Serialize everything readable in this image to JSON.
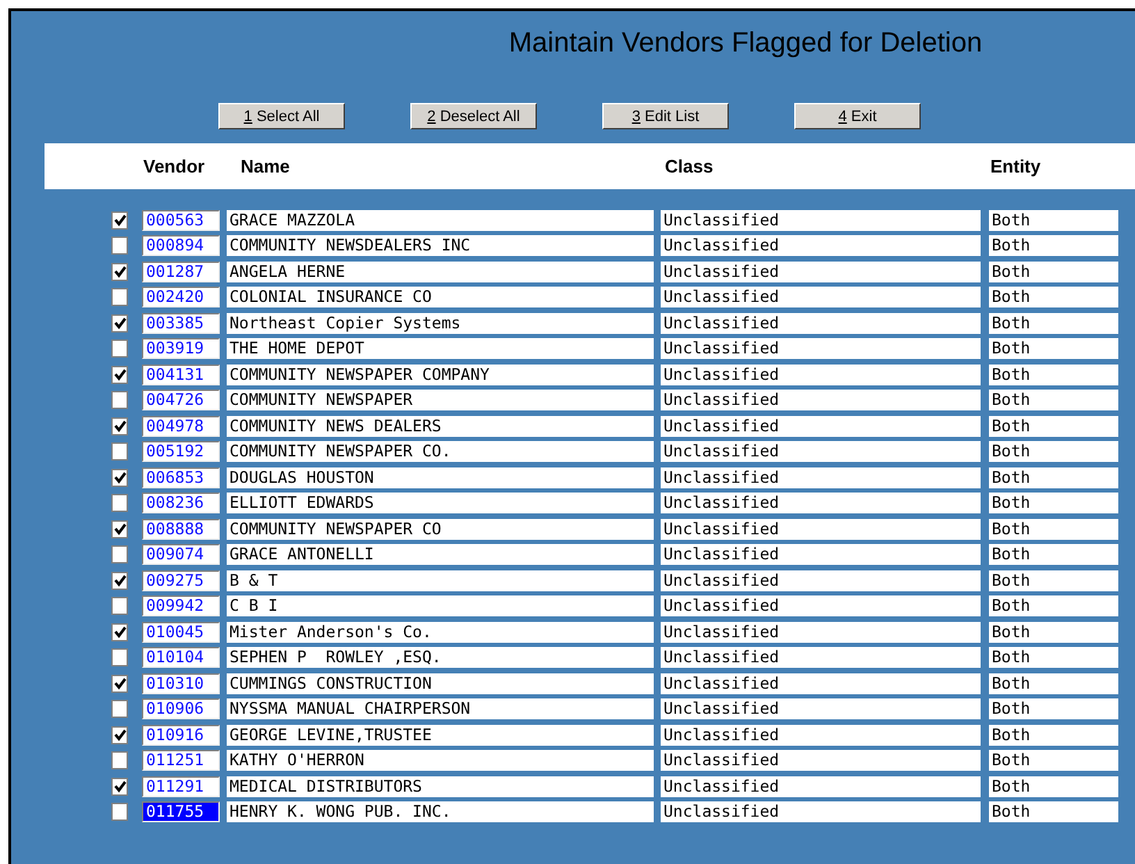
{
  "title": "Maintain Vendors Flagged for Deletion",
  "buttons": [
    {
      "key": "1",
      "label": "Select All"
    },
    {
      "key": "2",
      "label": "Deselect All"
    },
    {
      "key": "3",
      "label": "Edit List"
    },
    {
      "key": "4",
      "label": "Exit"
    }
  ],
  "columns": [
    "Vendor",
    "Name",
    "Class",
    "Entity"
  ],
  "rows": [
    {
      "checked": true,
      "vendor": "000563",
      "name": "GRACE MAZZOLA",
      "class": "Unclassified",
      "entity": "Both",
      "selected": false
    },
    {
      "checked": false,
      "vendor": "000894",
      "name": "COMMUNITY NEWSDEALERS INC",
      "class": "Unclassified",
      "entity": "Both",
      "selected": false
    },
    {
      "checked": true,
      "vendor": "001287",
      "name": "ANGELA HERNE",
      "class": "Unclassified",
      "entity": "Both",
      "selected": false
    },
    {
      "checked": false,
      "vendor": "002420",
      "name": "COLONIAL INSURANCE CO",
      "class": "Unclassified",
      "entity": "Both",
      "selected": false
    },
    {
      "checked": true,
      "vendor": "003385",
      "name": "Northeast Copier Systems",
      "class": "Unclassified",
      "entity": "Both",
      "selected": false
    },
    {
      "checked": false,
      "vendor": "003919",
      "name": "THE HOME DEPOT",
      "class": "Unclassified",
      "entity": "Both",
      "selected": false
    },
    {
      "checked": true,
      "vendor": "004131",
      "name": "COMMUNITY NEWSPAPER COMPANY",
      "class": "Unclassified",
      "entity": "Both",
      "selected": false
    },
    {
      "checked": false,
      "vendor": "004726",
      "name": "COMMUNITY NEWSPAPER",
      "class": "Unclassified",
      "entity": "Both",
      "selected": false
    },
    {
      "checked": true,
      "vendor": "004978",
      "name": "COMMUNITY NEWS DEALERS",
      "class": "Unclassified",
      "entity": "Both",
      "selected": false
    },
    {
      "checked": false,
      "vendor": "005192",
      "name": "COMMUNITY NEWSPAPER CO.",
      "class": "Unclassified",
      "entity": "Both",
      "selected": false
    },
    {
      "checked": true,
      "vendor": "006853",
      "name": "DOUGLAS HOUSTON",
      "class": "Unclassified",
      "entity": "Both",
      "selected": false
    },
    {
      "checked": false,
      "vendor": "008236",
      "name": "ELLIOTT EDWARDS",
      "class": "Unclassified",
      "entity": "Both",
      "selected": false
    },
    {
      "checked": true,
      "vendor": "008888",
      "name": "COMMUNITY NEWSPAPER CO",
      "class": "Unclassified",
      "entity": "Both",
      "selected": false
    },
    {
      "checked": false,
      "vendor": "009074",
      "name": "GRACE ANTONELLI",
      "class": "Unclassified",
      "entity": "Both",
      "selected": false
    },
    {
      "checked": true,
      "vendor": "009275",
      "name": "B & T",
      "class": "Unclassified",
      "entity": "Both",
      "selected": false
    },
    {
      "checked": false,
      "vendor": "009942",
      "name": "C B I",
      "class": "Unclassified",
      "entity": "Both",
      "selected": false
    },
    {
      "checked": true,
      "vendor": "010045",
      "name": "Mister Anderson's Co.",
      "class": "Unclassified",
      "entity": "Both",
      "selected": false
    },
    {
      "checked": false,
      "vendor": "010104",
      "name": "SEPHEN P  ROWLEY ,ESQ.",
      "class": "Unclassified",
      "entity": "Both",
      "selected": false
    },
    {
      "checked": true,
      "vendor": "010310",
      "name": "CUMMINGS CONSTRUCTION",
      "class": "Unclassified",
      "entity": "Both",
      "selected": false
    },
    {
      "checked": false,
      "vendor": "010906",
      "name": "NYSSMA MANUAL CHAIRPERSON",
      "class": "Unclassified",
      "entity": "Both",
      "selected": false
    },
    {
      "checked": true,
      "vendor": "010916",
      "name": "GEORGE LEVINE,TRUSTEE",
      "class": "Unclassified",
      "entity": "Both",
      "selected": false
    },
    {
      "checked": false,
      "vendor": "011251",
      "name": "KATHY O'HERRON",
      "class": "Unclassified",
      "entity": "Both",
      "selected": false
    },
    {
      "checked": true,
      "vendor": "011291",
      "name": "MEDICAL DISTRIBUTORS",
      "class": "Unclassified",
      "entity": "Both",
      "selected": false
    },
    {
      "checked": false,
      "vendor": "011755",
      "name": "HENRY K. WONG PUB. INC.",
      "class": "Unclassified",
      "entity": "Both",
      "selected": true
    }
  ]
}
